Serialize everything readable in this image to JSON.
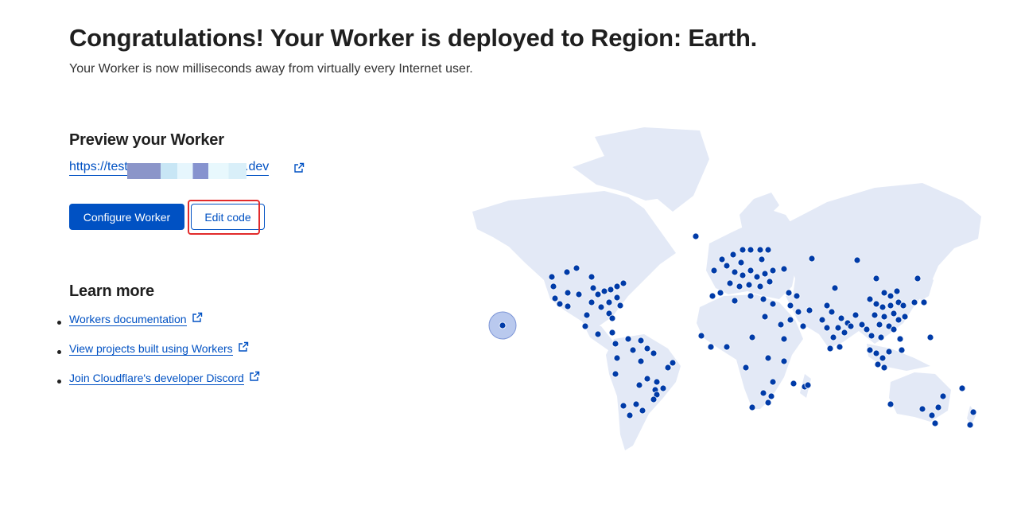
{
  "header": {
    "title": "Congratulations! Your Worker is deployed to Region: Earth.",
    "subtitle": "Your Worker is now milliseconds away from virtually every Internet user."
  },
  "preview": {
    "heading": "Preview your Worker",
    "url_prefix": "https://test",
    "url_suffix": "ers.dev",
    "link_icon": "external-link-icon"
  },
  "actions": {
    "configure_label": "Configure Worker",
    "edit_label": "Edit code"
  },
  "learn_more": {
    "heading": "Learn more",
    "links": [
      {
        "label": "Workers documentation",
        "icon": "external-link-icon"
      },
      {
        "label": "View projects built using Workers",
        "icon": "external-link-icon"
      },
      {
        "label": "Join Cloudflare's developer Discord",
        "icon": "external-link-icon"
      }
    ]
  },
  "map": {
    "land_color": "#e3e9f6",
    "dot_color": "#003ba8",
    "highlight_color": "#e22b2b",
    "brand_color": "#0051c3"
  }
}
